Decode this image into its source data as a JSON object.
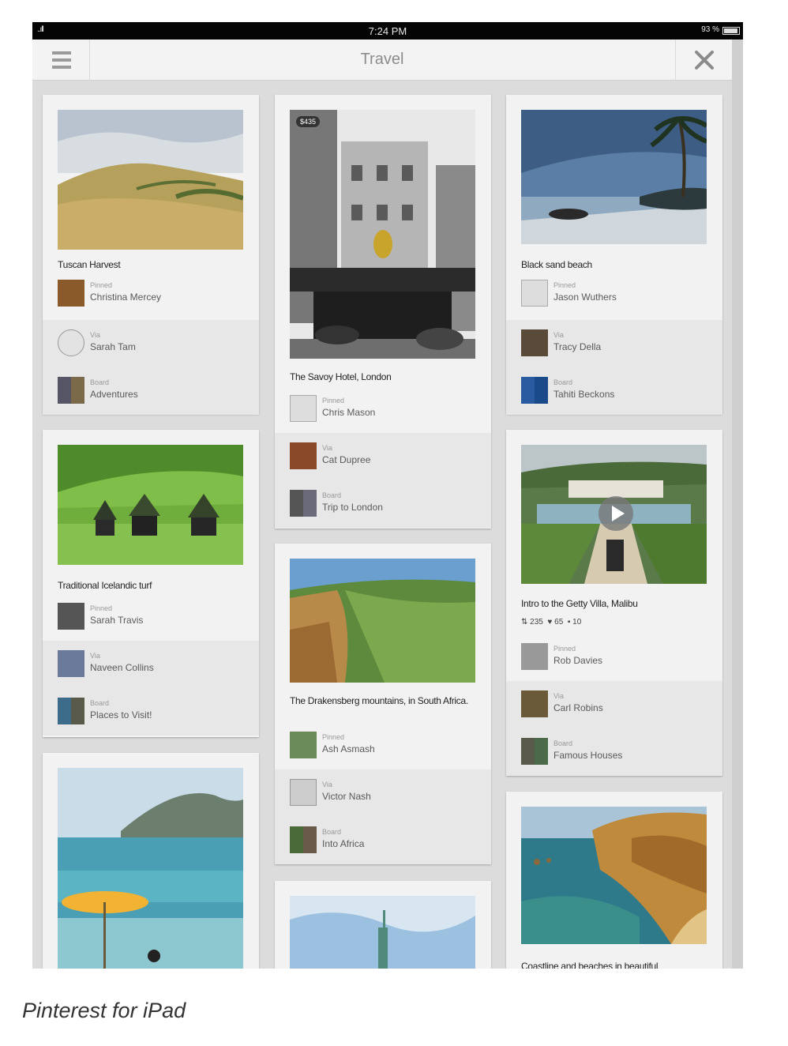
{
  "status_bar": {
    "signal": "..ıll",
    "time": "7:24 PM",
    "battery": "93 %"
  },
  "nav": {
    "title": "Travel"
  },
  "pins": {
    "tuscan": {
      "title": "Tuscan Harvest",
      "pinned_label": "Pinned",
      "pinned_by": "Christina Mercey",
      "via_label": "Via",
      "via": "Sarah Tam",
      "board_label": "Board",
      "board": "Adventures"
    },
    "savoy": {
      "price": "$435",
      "title": "The Savoy Hotel, London",
      "pinned_label": "Pinned",
      "pinned_by": "Chris Mason",
      "via_label": "Via",
      "via": "Cat Dupree",
      "board_label": "Board",
      "board": "Trip to London"
    },
    "blacksand": {
      "title": "Black sand beach",
      "pinned_label": "Pinned",
      "pinned_by": "Jason Wuthers",
      "via_label": "Via",
      "via": "Tracy Della",
      "board_label": "Board",
      "board": "Tahiti Beckons"
    },
    "iceland": {
      "title": "Traditional Icelandic turf",
      "pinned_label": "Pinned",
      "pinned_by": "Sarah Travis",
      "via_label": "Via",
      "via": "Naveen Collins",
      "board_label": "Board",
      "board": "Places to Visit!"
    },
    "getty": {
      "title": "Intro to the Getty Villa, Malibu",
      "repins": "235",
      "likes": "65",
      "comments": "10",
      "pinned_label": "Pinned",
      "pinned_by": "Rob Davies",
      "via_label": "Via",
      "via": "Carl Robins",
      "board_label": "Board",
      "board": "Famous Houses"
    },
    "drakensberg": {
      "title": "The Drakensberg mountains, in South Africa.",
      "pinned_label": "Pinned",
      "pinned_by": "Ash Asmash",
      "via_label": "Via",
      "via": "Victor Nash",
      "board_label": "Board",
      "board": "Into Africa"
    },
    "coastline": {
      "title": "Coastline and beaches in beautiful"
    }
  },
  "footer": {
    "caption": "Pinterest for iPad"
  }
}
